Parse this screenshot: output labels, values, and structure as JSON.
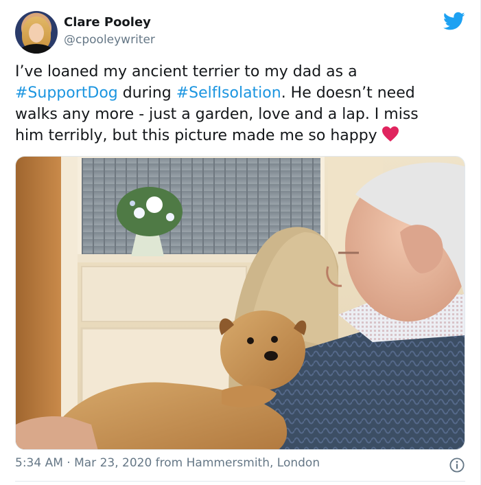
{
  "author": {
    "name": "Clare Pooley",
    "handle": "@cpooleywriter"
  },
  "tweet": {
    "line1": "I’ve loaned my ancient terrier to my dad as a",
    "tag1": "#SupportDog",
    "mid1": " during ",
    "tag2": "#SelfIsolation",
    "mid2": ". He doesn’t need",
    "line3": "walks any more - just a garden, love and a lap. I miss",
    "line4": "him terribly, but this picture made me so happy"
  },
  "meta": {
    "text": "5:34 AM · Mar 23, 2020 from Hammersmith, London"
  },
  "icons": {
    "brand": "twitter-bird-icon",
    "emoji": "red-heart-icon",
    "info": "info-icon"
  },
  "colors": {
    "link": "#1b95e0",
    "twitter_blue": "#1da1f2",
    "heart": "#e0245e",
    "muted": "#657786"
  }
}
